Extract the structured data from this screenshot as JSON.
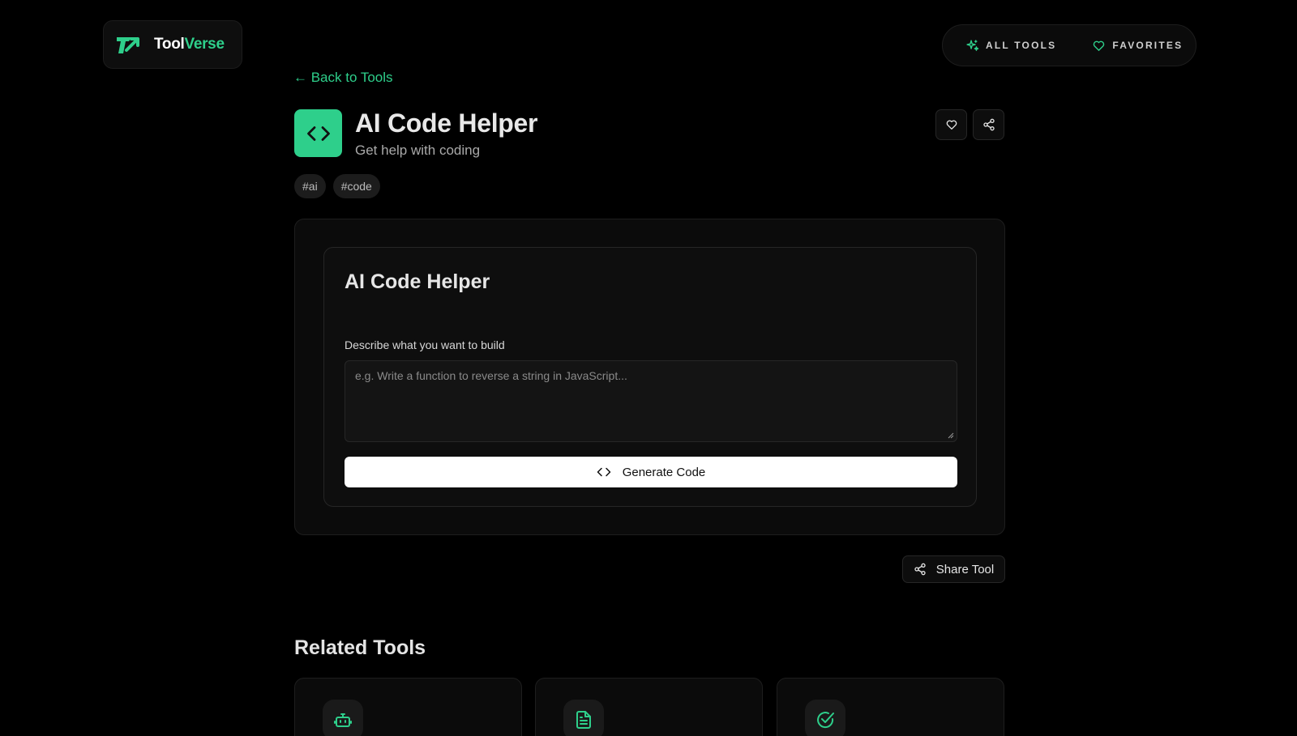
{
  "header": {
    "logo_part1": "Tool",
    "logo_part2": "Verse",
    "nav": [
      {
        "label": "ALL TOOLS",
        "icon": "sparkles-icon"
      },
      {
        "label": "FAVORITES",
        "icon": "heart-icon"
      }
    ]
  },
  "back_link": "← Back to Tools",
  "tool": {
    "title": "AI Code Helper",
    "subtitle": "Get help with coding",
    "icon": "code-icon",
    "tags": [
      "#ai",
      "#code"
    ]
  },
  "form": {
    "title": "AI Code Helper",
    "label": "Describe what you want to build",
    "placeholder": "e.g. Write a function to reverse a string in JavaScript...",
    "value": "",
    "button_label": "Generate Code"
  },
  "share_tool_label": "Share Tool",
  "related": {
    "title": "Related Tools",
    "items": [
      {
        "icon": "robot-icon"
      },
      {
        "icon": "document-icon"
      },
      {
        "icon": "check-circle-icon"
      }
    ]
  },
  "colors": {
    "accent": "#2ecf8b",
    "background": "#000000",
    "card": "#0b0b0b"
  }
}
